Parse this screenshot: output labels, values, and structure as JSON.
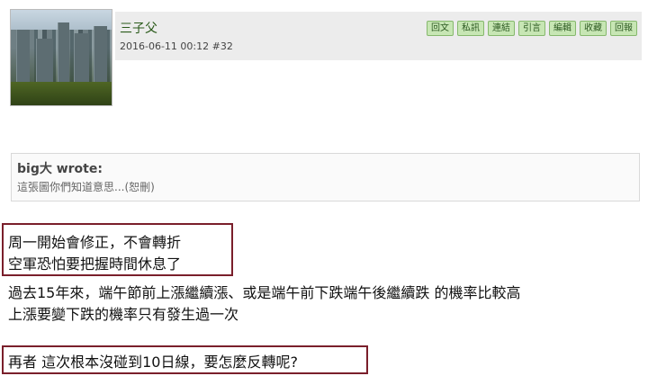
{
  "post": {
    "author": "三子父",
    "meta": "2016-06-11 00:12  #32"
  },
  "actions": [
    "回文",
    "私訊",
    "連結",
    "引言",
    "編輯",
    "收藏",
    "回報"
  ],
  "quote": {
    "author": "big大 wrote:",
    "text": "這張圖你們知道意思...(恕刪)"
  },
  "body": {
    "line1": "周一開始會修正，不會轉折",
    "line2": "空軍恐怕要把握時間休息了",
    "line3": "過去15年來，端午節前上漲繼續漲、或是端午前下跌端午後繼續跌 的機率比較高",
    "line4": "上漲要變下跌的機率只有發生過一次",
    "line5": "再者 這次根本沒碰到10日線，要怎麼反轉呢?"
  },
  "colors": {
    "highlight_border": "#7a1f2b",
    "action_bg": "#c7e6b4",
    "action_text": "#2d5a22"
  }
}
